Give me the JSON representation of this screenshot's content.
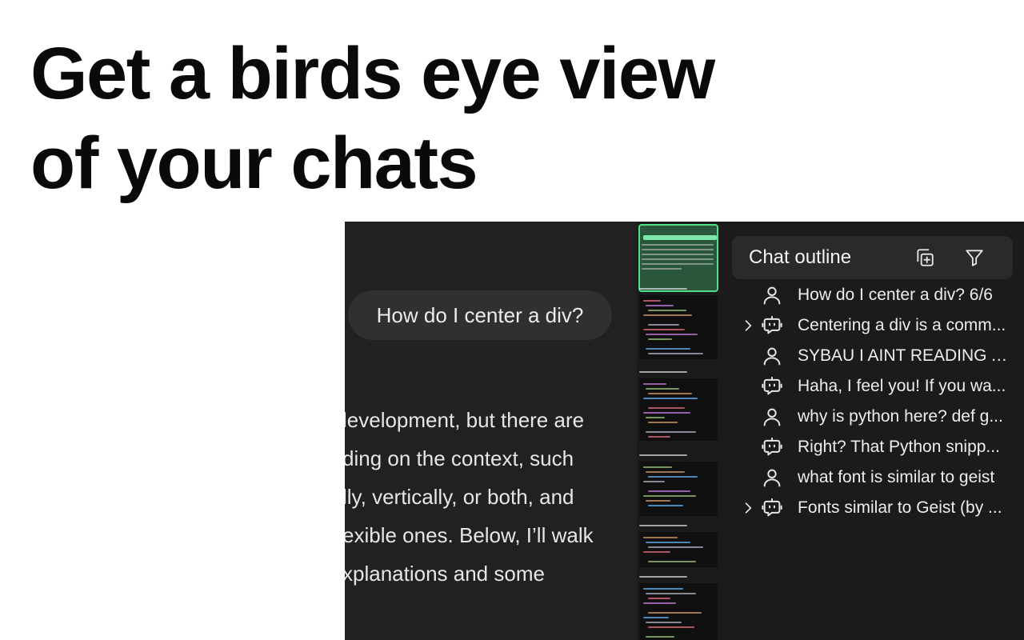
{
  "headline": {
    "line1": "Get a birds eye view",
    "line2": "of your chats"
  },
  "chat": {
    "user_message": "How do I center a div?",
    "reply_lines": [
      "levelopment, but there are",
      "ding on the context, such",
      "lly, vertically, or both, and",
      "exible ones. Below, I’ll walk",
      "xplanations and some"
    ]
  },
  "outline": {
    "title": "Chat outline",
    "copy_icon": "copy-plus-icon",
    "filter_icon": "filter-icon",
    "items": [
      {
        "role": "user",
        "label": "How do I center a div? 6/6",
        "expandable": false
      },
      {
        "role": "bot",
        "label": "Centering a div is a comm...",
        "expandable": true
      },
      {
        "role": "user",
        "label": "SYBAU I AINT READING A...",
        "expandable": false
      },
      {
        "role": "bot",
        "label": "Haha, I feel you! If you wa...",
        "expandable": false
      },
      {
        "role": "user",
        "label": "why is python here? def g...",
        "expandable": false
      },
      {
        "role": "bot",
        "label": "Right? That Python snipp...",
        "expandable": false
      },
      {
        "role": "user",
        "label": "what font is similar to geist",
        "expandable": false
      },
      {
        "role": "bot",
        "label": "Fonts similar to Geist (by ...",
        "expandable": true
      }
    ]
  },
  "colors": {
    "background": "#ffffff",
    "app_bg": "#212121",
    "minimap_highlight": "#4ee08a",
    "outline_bg": "#1b1b1c"
  }
}
